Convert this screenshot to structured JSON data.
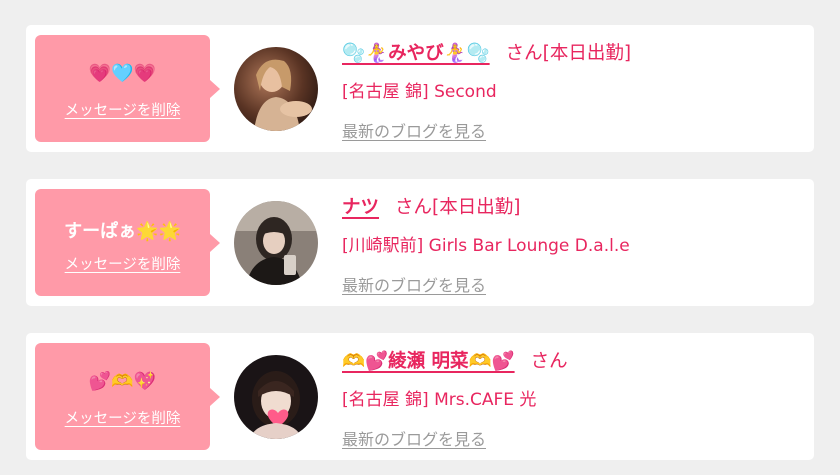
{
  "messages": [
    {
      "bubble_text": "💗🩵💗",
      "delete_label": "メッセージを削除",
      "name": "🫧🧜‍♀️みやび🧜‍♀️🫧",
      "honorific": "さん",
      "status": "[本日出勤]",
      "shop": "[名古屋 錦] Second",
      "blog_label": "最新のブログを見る"
    },
    {
      "bubble_text": "すーぱぁ🌟🌟",
      "delete_label": "メッセージを削除",
      "name": "ナツ",
      "honorific": "さん",
      "status": "[本日出勤]",
      "shop": "[川崎駅前] Girls Bar Lounge D.a.l.e",
      "blog_label": "最新のブログを見る"
    },
    {
      "bubble_text": "💕🫶💖",
      "delete_label": "メッセージを削除",
      "name": "🫶💕綾瀬 明菜🫶💕",
      "honorific": "さん",
      "status": "",
      "shop": "[名古屋 錦] Mrs.CAFE 光",
      "blog_label": "最新のブログを見る"
    }
  ],
  "colors": {
    "bubble": "#ff9aa8",
    "accent": "#e8265f",
    "link_gray": "#9a9a9a",
    "background": "#efefef"
  }
}
